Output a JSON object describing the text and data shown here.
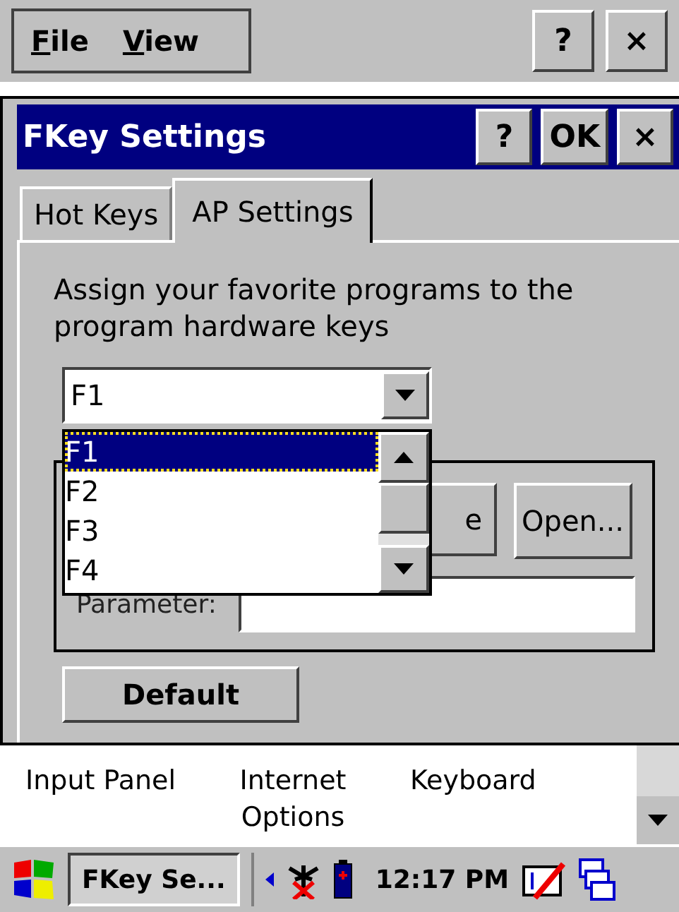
{
  "menu_bar": {
    "items": [
      "File",
      "View"
    ],
    "buttons": [
      "?",
      "×"
    ]
  },
  "dialog": {
    "title": "FKey Settings",
    "buttons": [
      "?",
      "OK",
      "×"
    ],
    "tabs": [
      {
        "label": "Hot Keys",
        "selected": false
      },
      {
        "label": "AP Settings",
        "selected": true
      }
    ],
    "description": "Assign your favorite programs to the program hardware keys",
    "key_select": {
      "value": "F1",
      "expanded": true,
      "options": [
        {
          "label": "F1",
          "selected": true
        },
        {
          "label": "F2",
          "selected": false
        },
        {
          "label": "F3",
          "selected": false
        },
        {
          "label": "F4",
          "selected": false
        }
      ]
    },
    "browse_button": "e",
    "open_button": "Open...",
    "parameter_label": "Parameter:",
    "default_button": "Default"
  },
  "control_panel": {
    "items": [
      "Input Panel",
      "Internet Options",
      "Keyboard"
    ]
  },
  "taskbar": {
    "task": "FKey Se...",
    "time": "12:17 PM"
  }
}
